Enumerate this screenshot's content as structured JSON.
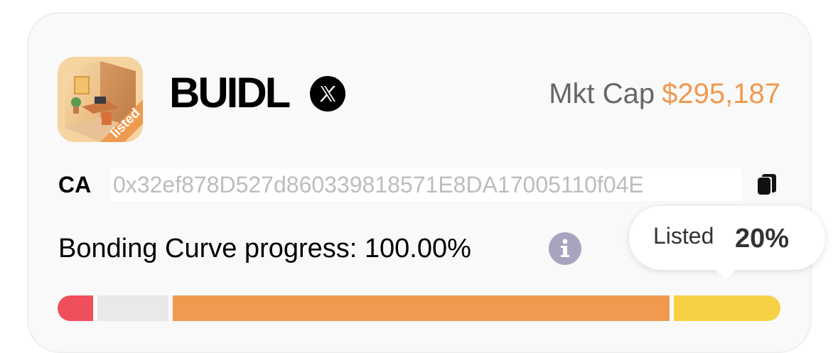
{
  "token": {
    "name": "BUIDL",
    "image_badge": "listed",
    "social_icon": "x-twitter-icon"
  },
  "market_cap": {
    "label": "Mkt Cap",
    "value": "$295,187",
    "value_color": "#ef9a4f"
  },
  "contract": {
    "label": "CA",
    "address": "0x32ef878D527d860339818571E8DA17005110f04E",
    "copy_icon": "copy-icon"
  },
  "bonding_curve": {
    "text": "Bonding Curve progress: 100.00%",
    "progress": 1.0,
    "info_icon": "info-icon"
  },
  "tooltip": {
    "label": "Listed",
    "value": "20%"
  },
  "progress_segments": [
    {
      "name": "red-segment",
      "fraction": 0.05,
      "color": "#ef4f5a"
    },
    {
      "name": "empty-segment",
      "fraction": 0.1,
      "color": "#e9e9e9"
    },
    {
      "name": "orange-segment",
      "fraction": 0.7,
      "color": "#ef9a4f"
    },
    {
      "name": "listed-segment",
      "fraction": 0.15,
      "color": "#f6d145"
    }
  ]
}
